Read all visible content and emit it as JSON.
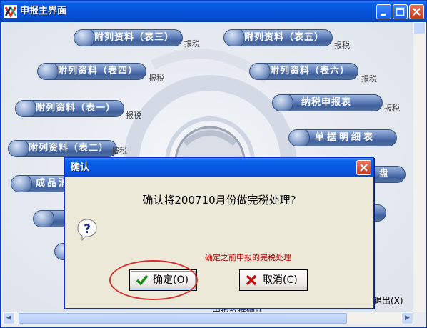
{
  "main_window": {
    "title": "申报主界面",
    "pills": [
      {
        "name": "pill-attach-3",
        "label": "附列资料（表三）",
        "tax": "报税"
      },
      {
        "name": "pill-attach-5",
        "label": "附列资料（表五）",
        "tax": "报税"
      },
      {
        "name": "pill-attach-4",
        "label": "附列资料（表四）",
        "tax": "报税"
      },
      {
        "name": "pill-attach-6",
        "label": "附列资料（表六）",
        "tax": "报税"
      },
      {
        "name": "pill-attach-1",
        "label": "附列资料（表一）",
        "tax": "报税"
      },
      {
        "name": "pill-tax-return",
        "label": "纳税申报表",
        "tax": "报税"
      },
      {
        "name": "pill-attach-2",
        "label": "附列资料（表二）",
        "tax": "报税"
      },
      {
        "name": "pill-detail",
        "label": "单据明细表",
        "tax": ""
      },
      {
        "name": "pill-finished-goods",
        "label": "成品消",
        "tax": ""
      },
      {
        "name": "pill-disk",
        "label": "盘",
        "tax": ""
      }
    ],
    "exit_label": "退出(X)",
    "partial_bottom_text": "申报数据确认"
  },
  "dialog": {
    "title": "确认",
    "message": "确认将200710月份做完税处理?",
    "note": "确定之前申报的完税处理",
    "ok_label": "确定(O)",
    "cancel_label": "取消(C)",
    "icon": "question-icon"
  },
  "colors": {
    "titlebar": "#0553da",
    "dialog_bg": "#ece9d8",
    "note_text": "#b00000",
    "highlight": "#d43030"
  }
}
